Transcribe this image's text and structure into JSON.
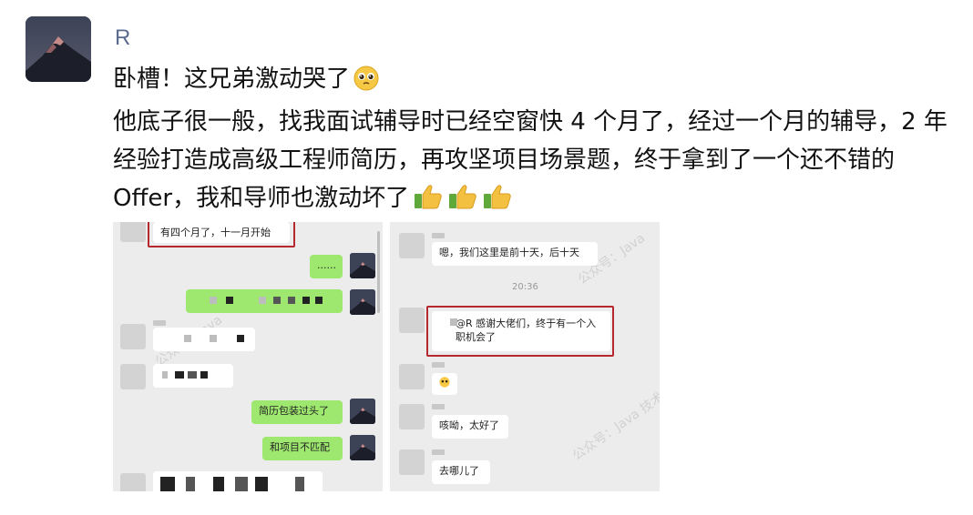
{
  "author": {
    "name": "R"
  },
  "post": {
    "line1": "卧槽！这兄弟激动哭了",
    "body": "他底子很一般，找我面试辅导时已经空窗快 4 个月了，经过一个月的辅导，2 年经验打造成高级工程师简历，再攻坚项目场景题，终于拿到了一个还不错的 Offer，我和导师也激动坏了",
    "emoji_line1": "pleading-face-emoji",
    "emoji_end": "thumbs-up-emoji x3"
  },
  "left_chat": {
    "highlighted_message": "有四个月了，十一月开始",
    "messages": [
      "......",
      "简历包装过头了",
      "和项目不匹配"
    ]
  },
  "right_chat": {
    "messages": [
      "嗯，我们这里是前十天，后十天",
      "@R 感谢大佬们，终于有一个入职机会了",
      "咳呦，太好了",
      "去哪儿了"
    ],
    "timestamp": "20:36"
  },
  "watermarks": [
    "公众号：Java",
    "公众号：Java 技术栈"
  ],
  "colors": {
    "author_name": "#5b6b8f",
    "highlight_border": "#b7282e",
    "chat_bg": "#ececec",
    "my_bubble": "#9fe870"
  }
}
